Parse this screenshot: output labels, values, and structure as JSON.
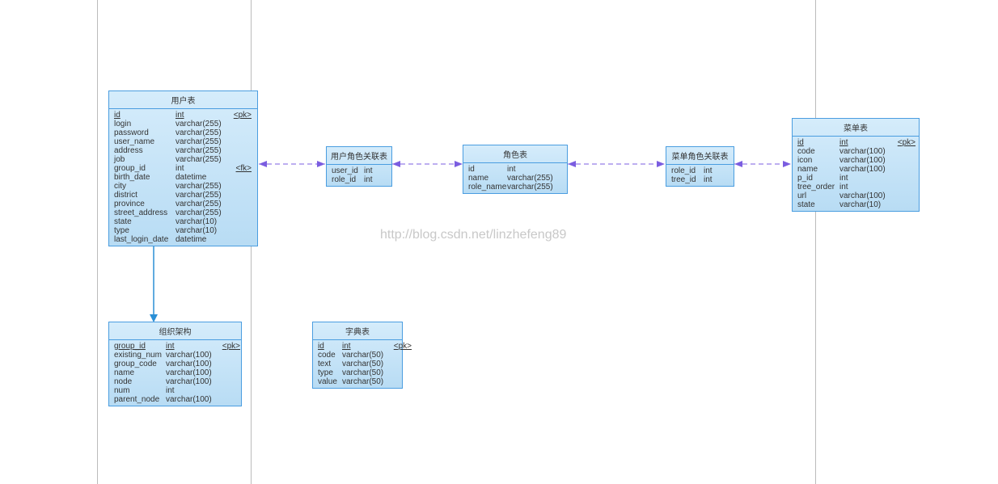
{
  "watermark": "http://blog.csdn.net/linzhefeng89",
  "vlines": [
    120,
    310,
    1008
  ],
  "entities": {
    "user": {
      "title": "用户表",
      "cols": [
        {
          "name": "id",
          "type": "int",
          "key": "<pk>",
          "u": true
        },
        {
          "name": "login",
          "type": "varchar(255)",
          "key": ""
        },
        {
          "name": "password",
          "type": "varchar(255)",
          "key": ""
        },
        {
          "name": "user_name",
          "type": "varchar(255)",
          "key": ""
        },
        {
          "name": "address",
          "type": "varchar(255)",
          "key": ""
        },
        {
          "name": "job",
          "type": "varchar(255)",
          "key": ""
        },
        {
          "name": "group_id",
          "type": "int",
          "key": "<fk>"
        },
        {
          "name": "birth_date",
          "type": "datetime",
          "key": ""
        },
        {
          "name": "city",
          "type": "varchar(255)",
          "key": ""
        },
        {
          "name": "district",
          "type": "varchar(255)",
          "key": ""
        },
        {
          "name": "province",
          "type": "varchar(255)",
          "key": ""
        },
        {
          "name": "street_address",
          "type": "varchar(255)",
          "key": ""
        },
        {
          "name": "state",
          "type": "varchar(10)",
          "key": ""
        },
        {
          "name": "type",
          "type": "varchar(10)",
          "key": ""
        },
        {
          "name": "last_login_date",
          "type": "datetime",
          "key": ""
        }
      ]
    },
    "user_role": {
      "title": "用户角色关联表",
      "cols": [
        {
          "name": "user_id",
          "type": "int",
          "key": ""
        },
        {
          "name": "role_id",
          "type": "int",
          "key": ""
        }
      ]
    },
    "role": {
      "title": "角色表",
      "cols": [
        {
          "name": "id",
          "type": "int",
          "key": ""
        },
        {
          "name": "name",
          "type": "varchar(255)",
          "key": ""
        },
        {
          "name": "role_name",
          "type": "varchar(255)",
          "key": ""
        }
      ]
    },
    "menu_role": {
      "title": "菜单角色关联表",
      "cols": [
        {
          "name": "role_id",
          "type": "int",
          "key": ""
        },
        {
          "name": "tree_id",
          "type": "int",
          "key": ""
        }
      ]
    },
    "menu": {
      "title": "菜单表",
      "cols": [
        {
          "name": "id",
          "type": "int",
          "key": "<pk>",
          "u": true
        },
        {
          "name": "code",
          "type": "varchar(100)",
          "key": ""
        },
        {
          "name": "icon",
          "type": "varchar(100)",
          "key": ""
        },
        {
          "name": "name",
          "type": "varchar(100)",
          "key": ""
        },
        {
          "name": "p_id",
          "type": "int",
          "key": ""
        },
        {
          "name": "tree_order",
          "type": "int",
          "key": ""
        },
        {
          "name": "url",
          "type": "varchar(100)",
          "key": ""
        },
        {
          "name": "state",
          "type": "varchar(10)",
          "key": ""
        }
      ]
    },
    "org": {
      "title": "组织架构",
      "cols": [
        {
          "name": "group_id",
          "type": "int",
          "key": "<pk>",
          "u": true
        },
        {
          "name": "existing_num",
          "type": "varchar(100)",
          "key": ""
        },
        {
          "name": "group_code",
          "type": "varchar(100)",
          "key": ""
        },
        {
          "name": "name",
          "type": "varchar(100)",
          "key": ""
        },
        {
          "name": "node",
          "type": "varchar(100)",
          "key": ""
        },
        {
          "name": "num",
          "type": "int",
          "key": ""
        },
        {
          "name": "parent_node",
          "type": "varchar(100)",
          "key": ""
        }
      ]
    },
    "dict": {
      "title": "字典表",
      "cols": [
        {
          "name": "id",
          "type": "int",
          "key": "<pk>",
          "u": true
        },
        {
          "name": "code",
          "type": "varchar(50)",
          "key": ""
        },
        {
          "name": "text",
          "type": "varchar(50)",
          "key": ""
        },
        {
          "name": "type",
          "type": "varchar(50)",
          "key": ""
        },
        {
          "name": "value",
          "type": "varchar(50)",
          "key": ""
        }
      ]
    }
  }
}
